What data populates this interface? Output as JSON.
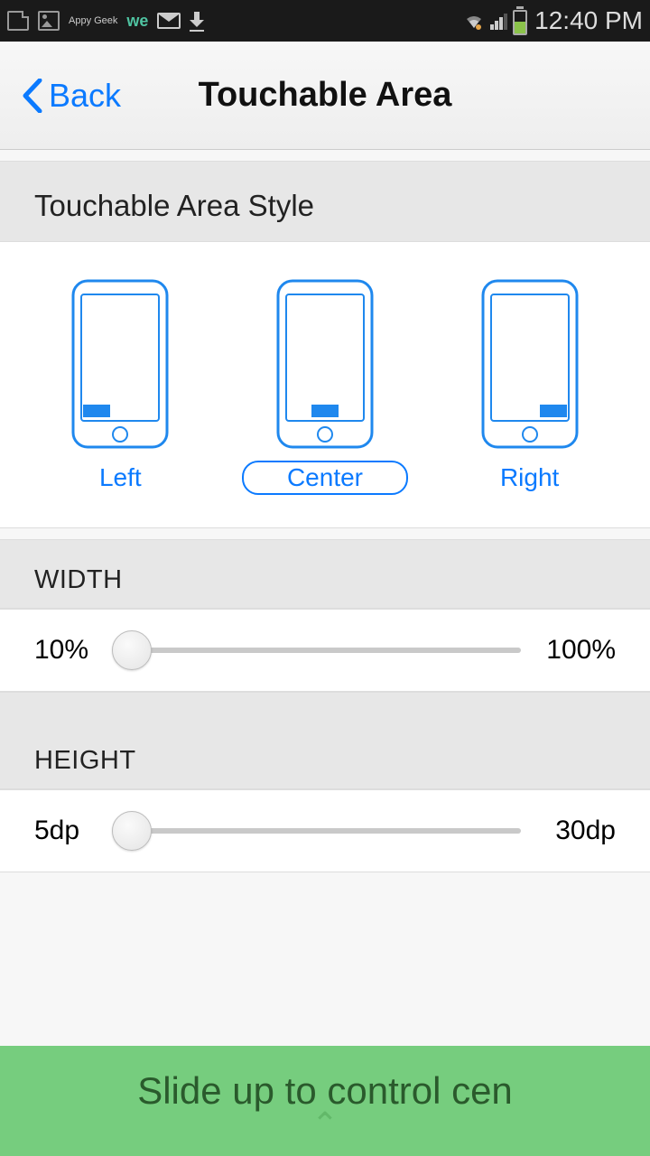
{
  "status_bar": {
    "time": "12:40 PM",
    "icons": {
      "appy": "Appy Geek"
    }
  },
  "header": {
    "back_label": "Back",
    "title": "Touchable Area"
  },
  "style_section": {
    "heading": "Touchable Area Style",
    "options": {
      "left": "Left",
      "center": "Center",
      "right": "Right"
    },
    "selected": "center"
  },
  "width_section": {
    "heading": "WIDTH",
    "min": "10%",
    "max": "100%"
  },
  "height_section": {
    "heading": "HEIGHT",
    "min": "5dp",
    "max": "30dp"
  },
  "footer": {
    "hint": "Slide up to control cen"
  }
}
